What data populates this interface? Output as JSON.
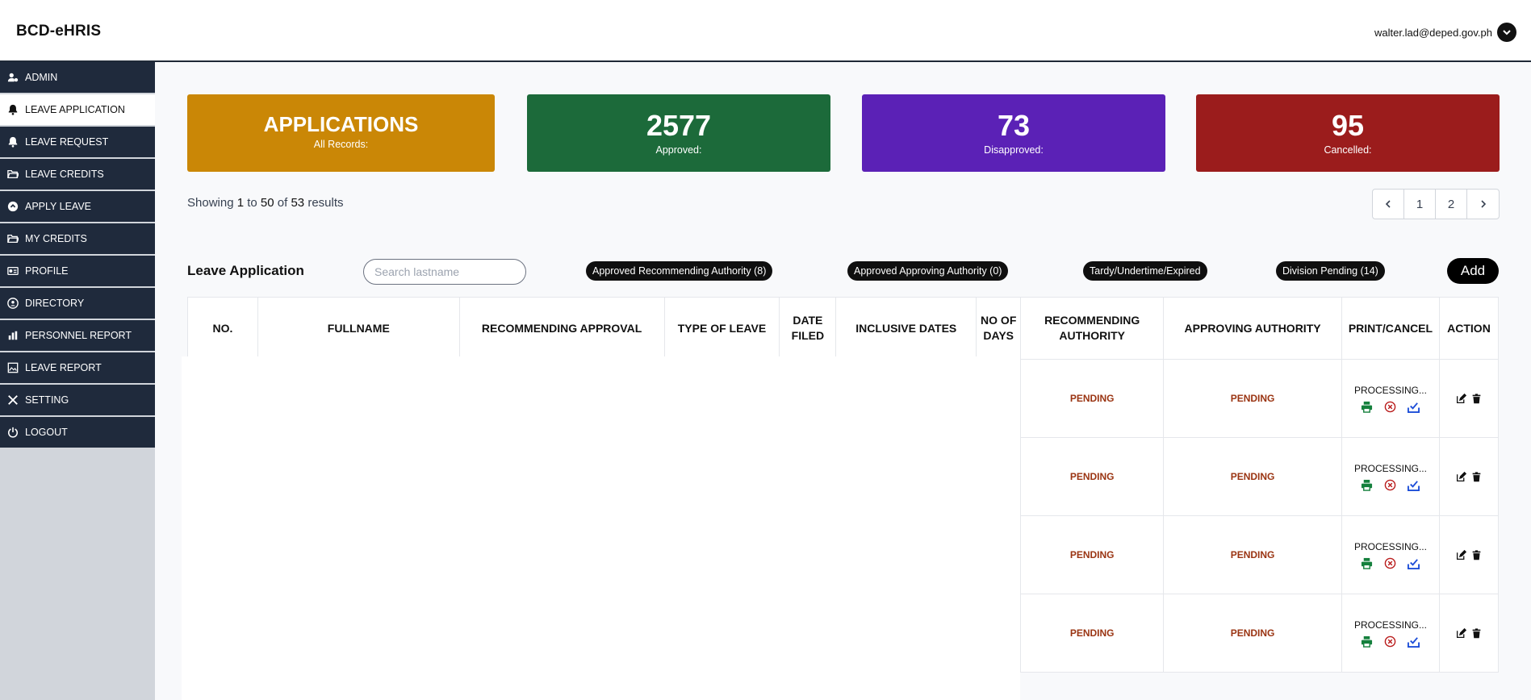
{
  "header": {
    "brand": "BCD-eHRIS",
    "user_email": "walter.lad@deped.gov.ph"
  },
  "sidebar": {
    "items": [
      {
        "label": "ADMIN",
        "icon": "user-cog-icon"
      },
      {
        "label": "LEAVE APPLICATION",
        "icon": "bell-icon"
      },
      {
        "label": "LEAVE REQUEST",
        "icon": "bell-icon"
      },
      {
        "label": "LEAVE CREDITS",
        "icon": "folder-open-icon"
      },
      {
        "label": "APPLY LEAVE",
        "icon": "arrow-circle-icon"
      },
      {
        "label": "MY CREDITS",
        "icon": "folder-open-icon"
      },
      {
        "label": "PROFILE",
        "icon": "id-card-icon"
      },
      {
        "label": "DIRECTORY",
        "icon": "address-book-icon"
      },
      {
        "label": "PERSONNEL REPORT",
        "icon": "bar-chart-icon"
      },
      {
        "label": "LEAVE REPORT",
        "icon": "image-report-icon"
      },
      {
        "label": "SETTING",
        "icon": "tools-icon"
      },
      {
        "label": "LOGOUT",
        "icon": "power-icon"
      }
    ],
    "active_index": 1
  },
  "stats": {
    "applications": {
      "title": "APPLICATIONS",
      "label": "All Records:"
    },
    "approved": {
      "value": "2577",
      "label": "Approved:"
    },
    "disapproved": {
      "value": "73",
      "label": "Disapproved:"
    },
    "cancelled": {
      "value": "95",
      "label": "Cancelled:"
    }
  },
  "results": {
    "prefix": "Showing",
    "from": "1",
    "to_word": "to",
    "to": "50",
    "of_word": "of",
    "total": "53",
    "suffix": "results"
  },
  "pagination": {
    "pages": [
      "1",
      "2"
    ]
  },
  "toolbar": {
    "title": "Leave Application",
    "search_placeholder": "Search lastname",
    "filters": [
      "Approved Recommending Authority (8)",
      "Approved Approving Authority (0)",
      "Tardy/Undertime/Expired",
      "Division Pending (14)"
    ],
    "add_label": "Add"
  },
  "table": {
    "columns": [
      "NO.",
      "FULLNAME",
      "RECOMMENDING APPROVAL",
      "TYPE OF LEAVE",
      "DATE FILED",
      "INCLUSIVE DATES",
      "NO OF DAYS",
      "RECOMMENDING AUTHORITY",
      "APPROVING AUTHORITY",
      "PRINT/CANCEL",
      "ACTION"
    ],
    "rows": [
      {
        "recommending": "PENDING",
        "approving": "PENDING",
        "status": "PROCESSING..."
      },
      {
        "recommending": "PENDING",
        "approving": "PENDING",
        "status": "PROCESSING..."
      },
      {
        "recommending": "PENDING",
        "approving": "PENDING",
        "status": "PROCESSING..."
      },
      {
        "recommending": "PENDING",
        "approving": "PENDING",
        "status": "PROCESSING..."
      }
    ]
  },
  "colors": {
    "applications": "#ca8706",
    "approved": "#1c6a3a",
    "disapproved": "#5b21b6",
    "cancelled": "#9b1c1c",
    "sidebar": "#1f2a3c",
    "pending": "#9a3412"
  }
}
